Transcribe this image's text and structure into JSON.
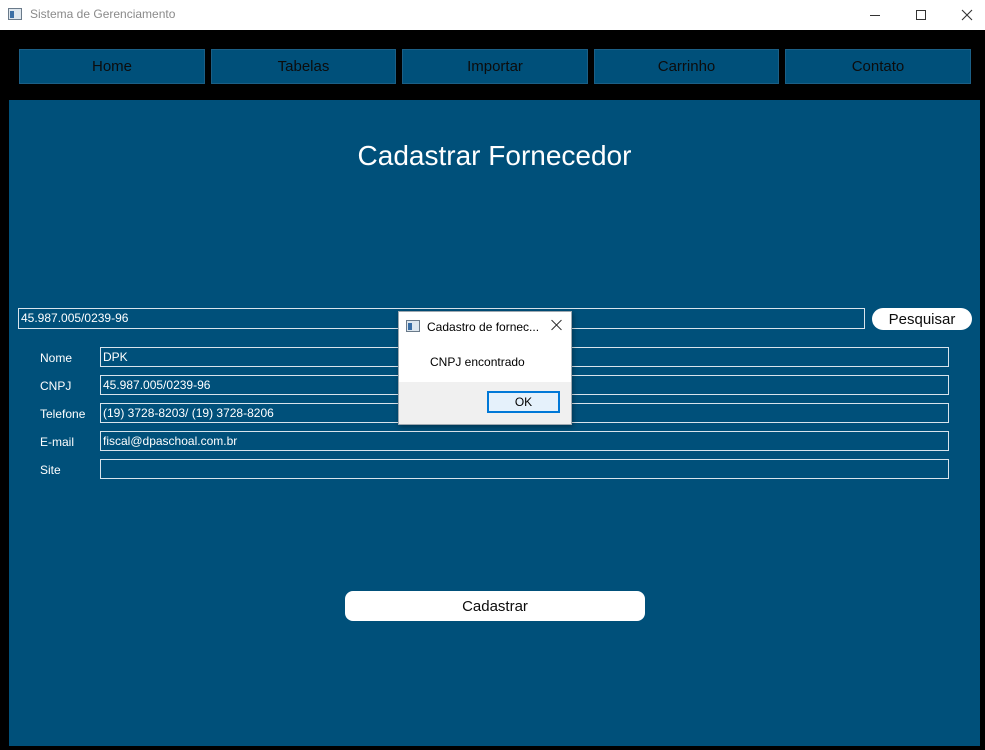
{
  "window": {
    "title": "Sistema de Gerenciamento"
  },
  "nav": {
    "items": [
      {
        "label": "Home"
      },
      {
        "label": "Tabelas"
      },
      {
        "label": "Importar"
      },
      {
        "label": "Carrinho"
      },
      {
        "label": "Contato"
      }
    ]
  },
  "page": {
    "title": "Cadastrar Fornecedor"
  },
  "search": {
    "value": "45.987.005/0239-96",
    "button_label": "Pesquisar"
  },
  "form": {
    "fields": [
      {
        "label": "Nome",
        "value": "DPK"
      },
      {
        "label": "CNPJ",
        "value": "45.987.005/0239-96"
      },
      {
        "label": "Telefone",
        "value": "(19) 3728-8203/ (19) 3728-8206"
      },
      {
        "label": "E-mail",
        "value": "fiscal@dpaschoal.com.br"
      },
      {
        "label": "Site",
        "value": ""
      }
    ],
    "submit_label": "Cadastrar"
  },
  "dialog": {
    "title": "Cadastro de fornec...",
    "message": "CNPJ encontrado",
    "ok_label": "OK"
  },
  "colors": {
    "panel": "#00507a",
    "background": "#000000",
    "text": "#ffffff",
    "button": "#ffffff"
  }
}
